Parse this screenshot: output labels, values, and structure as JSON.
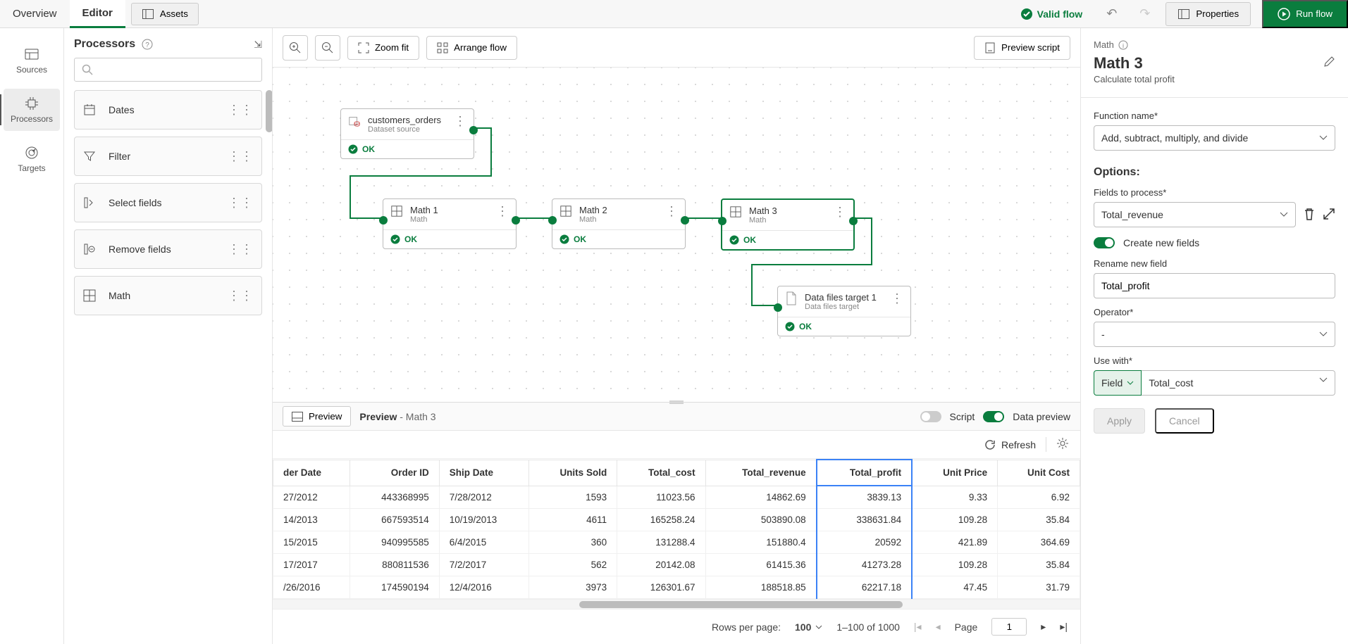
{
  "top": {
    "tabs": [
      "Overview",
      "Editor"
    ],
    "active_tab": 1,
    "assets": "Assets",
    "valid": "Valid flow",
    "properties": "Properties",
    "run": "Run flow"
  },
  "nav": [
    {
      "label": "Sources"
    },
    {
      "label": "Processors"
    },
    {
      "label": "Targets"
    }
  ],
  "left": {
    "title": "Processors",
    "items": [
      "Dates",
      "Filter",
      "Select fields",
      "Remove fields",
      "Math"
    ]
  },
  "canvas": {
    "zoom_fit": "Zoom fit",
    "arrange": "Arrange flow",
    "preview_script": "Preview script",
    "nodes": {
      "src": {
        "title": "customers_orders",
        "sub": "Dataset source",
        "status": "OK"
      },
      "m1": {
        "title": "Math 1",
        "sub": "Math",
        "status": "OK"
      },
      "m2": {
        "title": "Math 2",
        "sub": "Math",
        "status": "OK"
      },
      "m3": {
        "title": "Math 3",
        "sub": "Math",
        "status": "OK"
      },
      "tgt": {
        "title": "Data files target 1",
        "sub": "Data files target",
        "status": "OK"
      }
    }
  },
  "preview_bar": {
    "button": "Preview",
    "label": "Preview",
    "sub": "- Math 3",
    "script": "Script",
    "data_preview": "Data preview"
  },
  "table": {
    "refresh": "Refresh",
    "cols": [
      "der Date",
      "Order ID",
      "Ship Date",
      "Units Sold",
      "Total_cost",
      "Total_revenue",
      "Total_profit",
      "Unit Price",
      "Unit Cost"
    ],
    "rows": [
      [
        "27/2012",
        "443368995",
        "7/28/2012",
        "1593",
        "11023.56",
        "14862.69",
        "3839.13",
        "9.33",
        "6.92"
      ],
      [
        "14/2013",
        "667593514",
        "10/19/2013",
        "4611",
        "165258.24",
        "503890.08",
        "338631.84",
        "109.28",
        "35.84"
      ],
      [
        "15/2015",
        "940995585",
        "6/4/2015",
        "360",
        "131288.4",
        "151880.4",
        "20592",
        "421.89",
        "364.69"
      ],
      [
        "17/2017",
        "880811536",
        "7/2/2017",
        "562",
        "20142.08",
        "61415.36",
        "41273.28",
        "109.28",
        "35.84"
      ],
      [
        "/26/2016",
        "174590194",
        "12/4/2016",
        "3973",
        "126301.67",
        "188518.85",
        "62217.18",
        "47.45",
        "31.79"
      ]
    ],
    "selected_col": 6,
    "pager": {
      "rows_label": "Rows per page:",
      "rows_value": "100",
      "range": "1–100 of 1000",
      "page_label": "Page",
      "page_value": "1"
    }
  },
  "right": {
    "crumb": "Math",
    "title": "Math 3",
    "desc": "Calculate total profit",
    "fn_label": "Function name*",
    "fn_value": "Add, subtract, multiply, and divide",
    "options": "Options:",
    "fields_label": "Fields to process*",
    "fields_value": "Total_revenue",
    "create_new": "Create new fields",
    "rename_label": "Rename new field",
    "rename_value": "Total_profit",
    "op_label": "Operator*",
    "op_value": "-",
    "use_label": "Use with*",
    "use_kind": "Field",
    "use_value": "Total_cost",
    "apply": "Apply",
    "cancel": "Cancel"
  }
}
